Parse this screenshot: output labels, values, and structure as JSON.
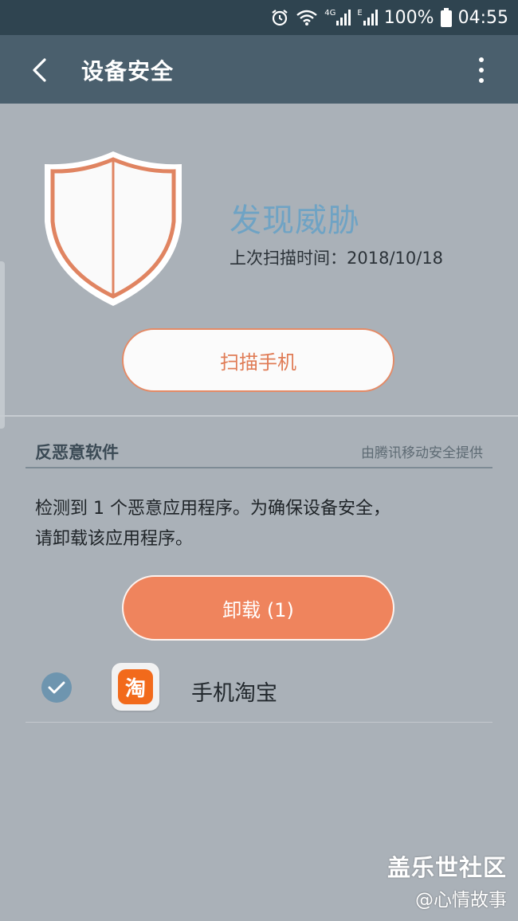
{
  "status_bar": {
    "network_1": "4G",
    "network_2": "E",
    "battery": "100%",
    "time": "04:55"
  },
  "app_bar": {
    "title": "设备安全"
  },
  "status": {
    "headline": "发现威胁",
    "last_scan": "上次扫描时间：2018/10/18"
  },
  "actions": {
    "scan_label": "扫描手机",
    "uninstall_label": "卸载 (1)"
  },
  "section": {
    "title": "反恶意软件",
    "provider": "由腾讯移动安全提供",
    "description_line1": "检测到 1 个恶意应用程序。为确保设备安全，",
    "description_line2": "请卸载该应用程序。"
  },
  "apps": [
    {
      "name": "手机淘宝",
      "icon_glyph": "淘",
      "checked": true
    }
  ],
  "watermark": {
    "brand": "盖乐世社区",
    "user": "@心情故事"
  },
  "colors": {
    "background": "#aab1b8",
    "status_bar": "#2f4450",
    "app_bar": "#4a5f6d",
    "accent_orange": "#ef845d",
    "headline_blue": "#6fa3c4",
    "check_blue": "#6e95af"
  },
  "icons": [
    "back-arrow-icon",
    "more-vert-icon",
    "alarm-icon",
    "wifi-icon",
    "signal-icon",
    "battery-icon",
    "shield-icon",
    "check-icon",
    "taobao-app-icon"
  ]
}
